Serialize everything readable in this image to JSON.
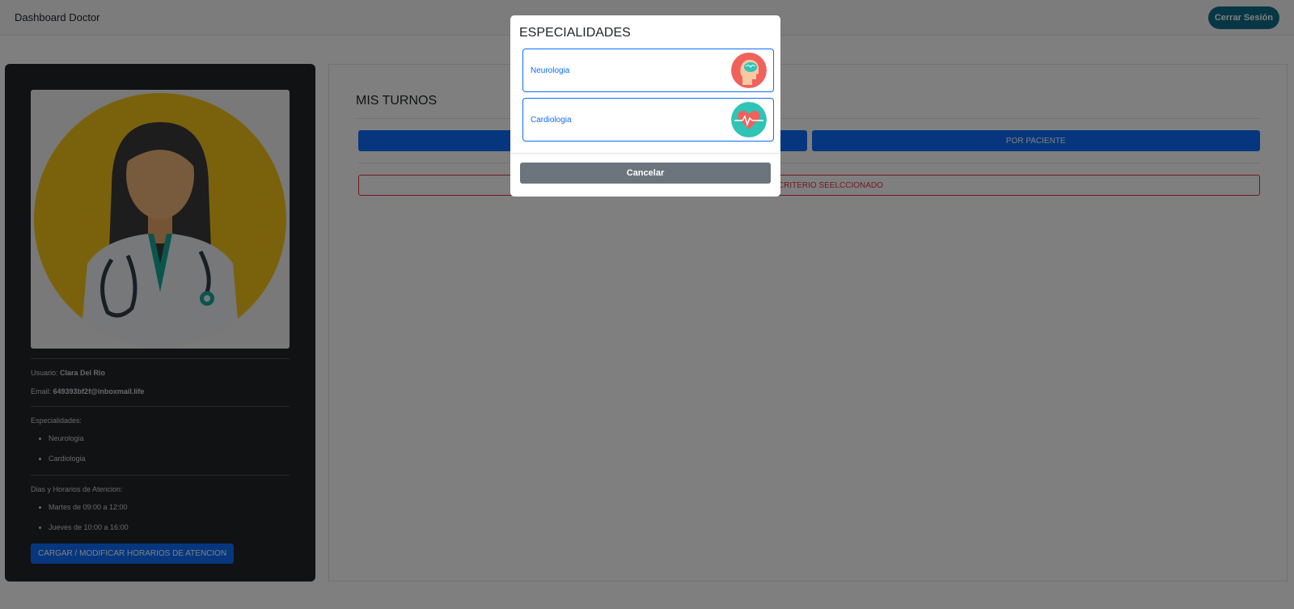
{
  "navbar": {
    "brand": "Dashboard Doctor",
    "logout_label": "Cerrar Sesión"
  },
  "profile": {
    "user_label": "Usuario:",
    "user_name": "Clara Del Rio",
    "email_label": "Email:",
    "email": "649393bf2f@inboxmail.life",
    "specialties_label": "Especialidades:",
    "specialties": [
      "Neurologia",
      "Cardiologia"
    ],
    "schedule_label": "Dias y Horarios de Atencion:",
    "schedule": [
      "Martes de 09:00 a 12:00",
      "Jueves de 10:00 a 16:00"
    ],
    "schedule_button": "CARGAR / MODIFICAR HORARIOS DE ATENCION"
  },
  "main": {
    "title": "MIS TURNOS",
    "filter_buttons": [
      "",
      "POR PACIENTE"
    ],
    "alert": "S PARA EL CRITERIO SEELCCIONADO"
  },
  "modal": {
    "title": "ESPECIALIDADES",
    "items": [
      {
        "label": "Neurologia",
        "icon": "brain-head-icon",
        "color": "#f0615b"
      },
      {
        "label": "Cardiologia",
        "icon": "heart-pulse-icon",
        "color": "#2ec4b6"
      }
    ],
    "cancel_label": "Cancelar"
  },
  "colors": {
    "primary": "#0d6efd",
    "danger": "#dc3545",
    "secondary": "#6c757d",
    "sidebar": "#212529",
    "avatar_bg": "#f5c518"
  }
}
